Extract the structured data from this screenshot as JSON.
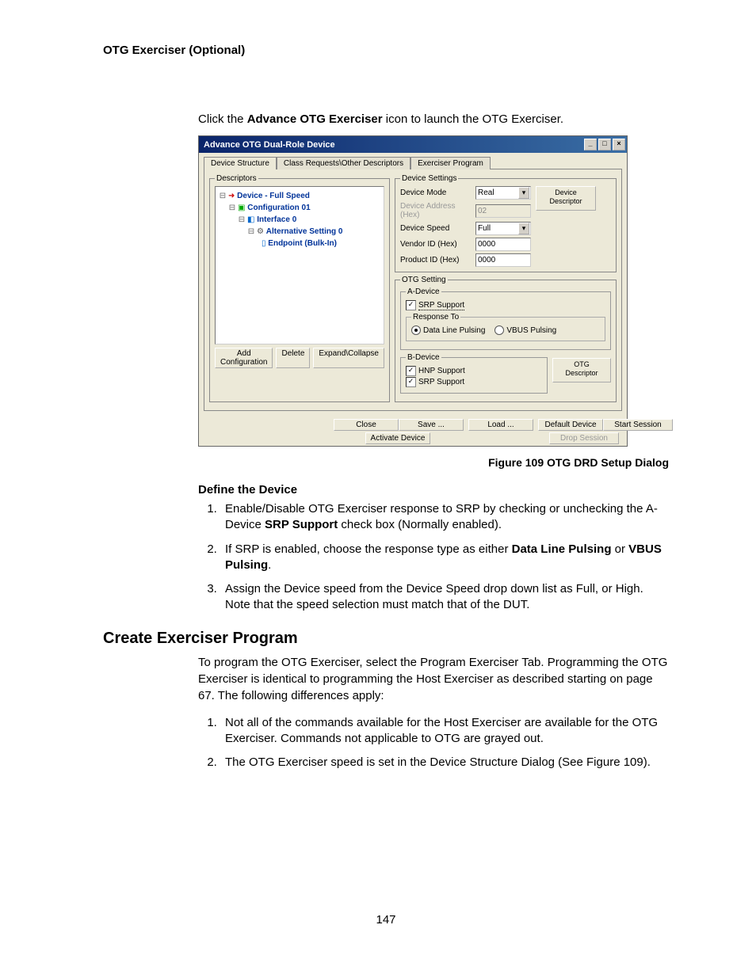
{
  "header": "OTG Exerciser (Optional)",
  "intro_pre": "Click the ",
  "intro_bold": "Advance OTG Exerciser",
  "intro_post": " icon to launch the OTG Exerciser.",
  "dialog": {
    "title": "Advance OTG Dual-Role Device",
    "tabs": {
      "device_structure": "Device Structure",
      "class_requests": "Class Requests\\Other Descriptors",
      "exerciser_program": "Exerciser Program"
    },
    "descriptors_legend": "Descriptors",
    "tree": {
      "device": "Device - Full Speed",
      "config": "Configuration 01",
      "interface": "Interface 0",
      "alt": "Alternative Setting 0",
      "endpoint": "Endpoint (Bulk-In)"
    },
    "btn_add_config": "Add Configuration",
    "btn_delete": "Delete",
    "btn_expand": "Expand\\Collapse",
    "device_settings": {
      "legend": "Device Settings",
      "mode_label": "Device Mode",
      "mode_value": "Real",
      "addr_label": "Device Address (Hex)",
      "addr_value": "02",
      "speed_label": "Device Speed",
      "speed_value": "Full",
      "vendor_label": "Vendor ID (Hex)",
      "vendor_value": "0000",
      "product_label": "Product ID (Hex)",
      "product_value": "0000",
      "btn_device_descriptor": "Device Descriptor"
    },
    "otg_setting": {
      "legend": "OTG Setting",
      "a_legend": "A-Device",
      "srp_support": "SRP Support",
      "response_to": "Response To",
      "data_line": "Data Line  Pulsing",
      "vbus": "VBUS Pulsing",
      "b_legend": "B-Device",
      "hnp_support": "HNP Support",
      "btn_otg_descriptor": "OTG Descriptor"
    },
    "btn_close": "Close",
    "btn_save": "Save ...",
    "btn_load": "Load ...",
    "btn_default": "Default Device",
    "btn_start": "Start Session",
    "btn_activate": "Activate Device",
    "btn_drop": "Drop Session"
  },
  "figure_caption": "Figure  109  OTG DRD Setup Dialog",
  "define_heading": "Define the Device",
  "steps_define": {
    "s1a": "Enable/Disable OTG Exerciser response to SRP by checking or unchecking the A-Device ",
    "s1b": "SRP Support",
    "s1c": " check box (Normally enabled).",
    "s2a": "If SRP is enabled, choose the response type as either ",
    "s2b": "Data Line Pulsing",
    "s2c": " or ",
    "s2d": "VBUS Pulsing",
    "s2e": ".",
    "s3": "Assign the Device speed from the Device Speed drop down list as Full, or High. Note that the speed selection must match that of the DUT."
  },
  "section2": "Create Exerciser Program",
  "para2": "To program the OTG Exerciser, select the Program Exerciser Tab. Programming the OTG Exerciser is identical to programming the Host Exerciser as described starting on page 67. The following differences apply:",
  "steps2": {
    "s1": "Not all of the commands available for the Host Exerciser are available for the OTG Exerciser. Commands not applicable to OTG are grayed out.",
    "s2": "The OTG Exerciser speed is set in the Device Structure Dialog (See Figure 109)."
  },
  "pagenum": "147"
}
